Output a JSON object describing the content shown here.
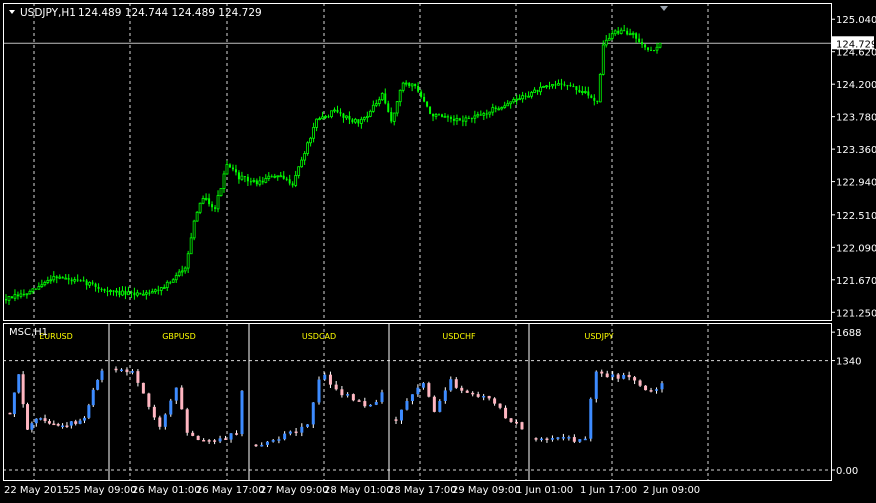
{
  "window": {
    "title": "USDJPY,H1",
    "ohlc_readout": "124.489 124.744 124.489 124.729"
  },
  "colors": {
    "background": "#000000",
    "frame": "#ffffff",
    "grid": "#ffffff",
    "bull": "#00ff00",
    "bear": "#00ff00",
    "sub_bull": "#3d8bff",
    "sub_bear": "#ffb6c1",
    "symbol_label": "#ffff00",
    "marker": "#9aa3ad"
  },
  "chart_data": [
    {
      "type": "candlestick",
      "title": "USDJPY,H1",
      "y_axis": {
        "ylim": [
          121.15,
          125.25
        ],
        "ticks": [
          125.04,
          124.62,
          124.2,
          123.78,
          123.36,
          122.94,
          122.51,
          122.09,
          121.67,
          121.25
        ],
        "tick_labels": [
          "125.040",
          "124.620",
          "124.200",
          "123.780",
          "123.360",
          "122.940",
          "122.510",
          "122.090",
          "121.670",
          "121.250"
        ]
      },
      "current_price": 124.729,
      "current_price_label": "124.729",
      "x_labels": [
        "22 May 2015",
        "25 May 09:00",
        "26 May 01:00",
        "26 May 17:00",
        "27 May 09:00",
        "28 May 01:00",
        "28 May 17:00",
        "29 May 09:00",
        "1 Jun 01:00",
        "1 Jun 17:00",
        "2 Jun 09:00"
      ],
      "bar_count": 220,
      "anchors": [
        [
          0,
          121.42
        ],
        [
          8,
          121.5
        ],
        [
          12,
          121.6
        ],
        [
          16,
          121.72
        ],
        [
          22,
          121.66
        ],
        [
          28,
          121.62
        ],
        [
          34,
          121.52
        ],
        [
          42,
          121.48
        ],
        [
          50,
          121.53
        ],
        [
          56,
          121.66
        ],
        [
          60,
          121.85
        ],
        [
          63,
          122.4
        ],
        [
          66,
          122.75
        ],
        [
          70,
          122.6
        ],
        [
          74,
          123.15
        ],
        [
          78,
          123.0
        ],
        [
          84,
          122.92
        ],
        [
          90,
          123.02
        ],
        [
          96,
          122.92
        ],
        [
          104,
          123.72
        ],
        [
          110,
          123.85
        ],
        [
          118,
          123.7
        ],
        [
          122,
          123.85
        ],
        [
          126,
          124.05
        ],
        [
          129,
          123.72
        ],
        [
          133,
          124.22
        ],
        [
          137,
          124.18
        ],
        [
          142,
          123.82
        ],
        [
          150,
          123.72
        ],
        [
          158,
          123.78
        ],
        [
          166,
          123.92
        ],
        [
          178,
          124.12
        ],
        [
          186,
          124.22
        ],
        [
          194,
          124.08
        ],
        [
          198,
          123.98
        ],
        [
          200,
          124.72
        ],
        [
          204,
          124.88
        ],
        [
          210,
          124.85
        ],
        [
          216,
          124.62
        ],
        [
          219,
          124.729
        ]
      ]
    },
    {
      "type": "candlestick",
      "title": "MSC,H1",
      "y_axis": {
        "ylim": [
          0,
          1800
        ],
        "ticks": [
          1688,
          1340,
          0
        ],
        "tick_labels": [
          "1688",
          "1340",
          "0.00"
        ],
        "dashed_levels": [
          1340,
          0
        ]
      },
      "panels": [
        {
          "symbol": "EURUSD",
          "bars": 22,
          "anchors": [
            [
              0,
              700
            ],
            [
              2,
              1160
            ],
            [
              4,
              470
            ],
            [
              6,
              620
            ],
            [
              10,
              560
            ],
            [
              14,
              570
            ],
            [
              17,
              620
            ],
            [
              20,
              1120
            ],
            [
              21,
              1230
            ]
          ]
        },
        {
          "symbol": "GBPUSD",
          "bars": 24,
          "anchors": [
            [
              0,
              1240
            ],
            [
              3,
              1220
            ],
            [
              6,
              760
            ],
            [
              8,
              520
            ],
            [
              11,
              1010
            ],
            [
              13,
              450
            ],
            [
              16,
              360
            ],
            [
              20,
              390
            ],
            [
              22,
              460
            ],
            [
              23,
              980
            ]
          ]
        },
        {
          "symbol": "USDCAD",
          "bars": 23,
          "anchors": [
            [
              0,
              310
            ],
            [
              4,
              400
            ],
            [
              7,
              480
            ],
            [
              9,
              560
            ],
            [
              11,
              1090
            ],
            [
              12,
              1180
            ],
            [
              14,
              960
            ],
            [
              16,
              920
            ],
            [
              19,
              800
            ],
            [
              21,
              830
            ],
            [
              22,
              950
            ]
          ]
        },
        {
          "symbol": "USDCHF",
          "bars": 24,
          "anchors": [
            [
              0,
              620
            ],
            [
              3,
              940
            ],
            [
              5,
              1050
            ],
            [
              7,
              700
            ],
            [
              10,
              1110
            ],
            [
              12,
              950
            ],
            [
              15,
              920
            ],
            [
              18,
              840
            ],
            [
              20,
              650
            ],
            [
              23,
              520
            ]
          ]
        },
        {
          "symbol": "USDJPY",
          "bars": 24,
          "anchors": [
            [
              0,
              390
            ],
            [
              4,
              410
            ],
            [
              7,
              360
            ],
            [
              9,
              380
            ],
            [
              10,
              870
            ],
            [
              11,
              1210
            ],
            [
              14,
              1140
            ],
            [
              17,
              1150
            ],
            [
              19,
              1040
            ],
            [
              21,
              950
            ],
            [
              23,
              1060
            ]
          ]
        }
      ]
    }
  ]
}
